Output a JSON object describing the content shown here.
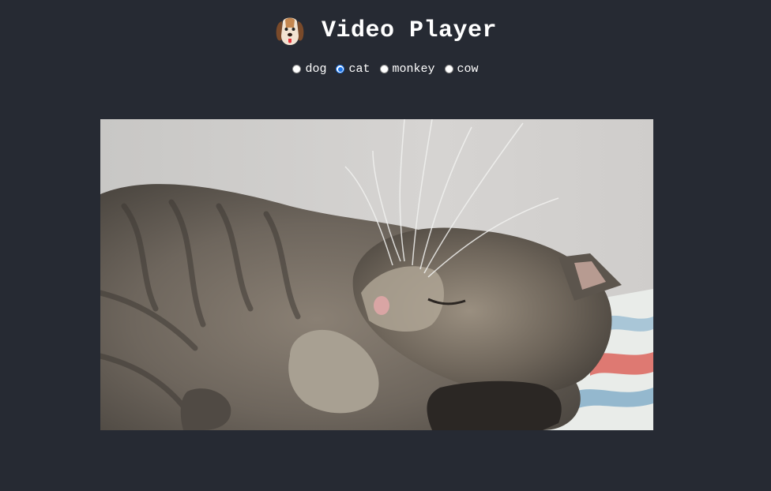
{
  "app": {
    "title": "Video Player",
    "logo_icon": "dog-face-icon"
  },
  "selector": {
    "options": [
      {
        "label": "dog",
        "selected": false
      },
      {
        "label": "cat",
        "selected": true
      },
      {
        "label": "monkey",
        "selected": false
      },
      {
        "label": "cow",
        "selected": false
      }
    ]
  },
  "video": {
    "subject": "cat",
    "frame_icon": "sleeping-cat-frame"
  },
  "colors": {
    "background": "#262a33",
    "text": "#ffffff",
    "radio_accent": "#1a73e8"
  }
}
